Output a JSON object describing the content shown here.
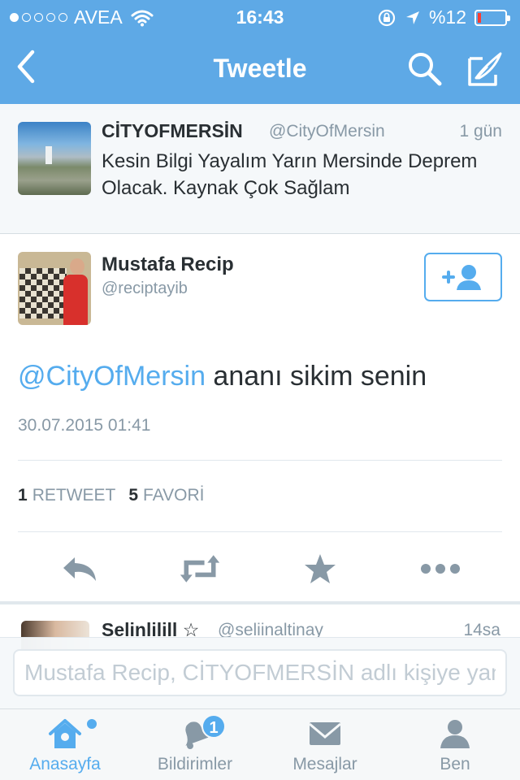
{
  "status_bar": {
    "carrier": "AVEA",
    "time": "16:43",
    "battery_text": "%12",
    "battery_level": 0.12,
    "signal_bars": 1,
    "signal_total": 5
  },
  "nav": {
    "title": "Tweetle",
    "back_icon": "chevron-left-icon",
    "search_icon": "search-icon",
    "compose_icon": "compose-icon"
  },
  "parent_tweet": {
    "name": "CİTYOFMERSİN",
    "handle": "@CityOfMersin",
    "time": "1 gün",
    "text": "Kesin Bilgi Yayalım Yarın Mersinde Deprem Olacak. Kaynak Çok Sağlam"
  },
  "tweet": {
    "name": "Mustafa Recip",
    "handle": "@reciptayib",
    "mention": "@CityOfMersin",
    "text": " ananı sikim senin",
    "date": "30.07.2015 01:41",
    "retweet_count": "1",
    "retweet_label": "RETWEET",
    "favorite_count": "5",
    "favorite_label": "FAVORİ"
  },
  "next_tweet": {
    "name": "Selinlilill ☆",
    "handle": "@seliinaltinay",
    "time": "14sa"
  },
  "reply": {
    "placeholder": "Mustafa Recip, CİTYOFMERSİN adlı kişiye yanıt ver"
  },
  "tabs": [
    {
      "label": "Anasayfa",
      "icon": "home-icon",
      "active": true
    },
    {
      "label": "Bildirimler",
      "icon": "bell-icon",
      "badge": "1"
    },
    {
      "label": "Mesajlar",
      "icon": "envelope-icon"
    },
    {
      "label": "Ben",
      "icon": "person-icon"
    }
  ],
  "colors": {
    "header": "#5ea9e6",
    "accent": "#55acee",
    "secondary_text": "#8899a6",
    "battery_low": "#ff3b30"
  }
}
